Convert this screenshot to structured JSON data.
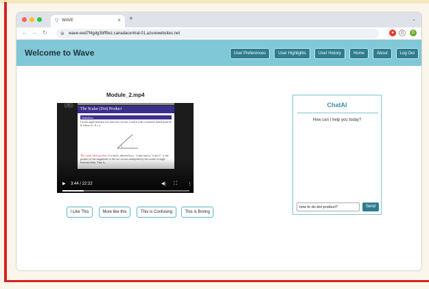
{
  "browser": {
    "tab_title": "WAVE",
    "new_tab": "+",
    "url": "wave-eed7f4gdg3bff9ez.canadacentral-01.azurewebsites.net",
    "profile_initial": "G"
  },
  "header": {
    "title": "Welcome to Wave",
    "nav": [
      "User Preferences",
      "User Highlights",
      "User History",
      "Home",
      "About",
      "Log Out"
    ],
    "color": "#80c7d7",
    "button_color": "#2e7d8f"
  },
  "video": {
    "title": "Module_2.mp4",
    "slide_heading": "The Scalar (Dot) Product",
    "slide_definition": "Definition",
    "slide_text": "Let the angle between two non-zero vectors u and b with a common initial point be θ, where 0 ≤ θ ≤ π.",
    "slide_text2_red": "The scalar (dot) product",
    "slide_text2": "of u and b, denoted by u · b and read as \"u dot b\", is the product of the magnitude of the two vectors multiplied by the cosine of angle between them. That is,",
    "time": "3:44 / 22:22",
    "progress": 0.17
  },
  "feedback_buttons": [
    "I Like This",
    "More like this",
    "This is Confusing",
    "This is Boring"
  ],
  "chat": {
    "title": "ChatAI",
    "greeting": "How can I help you today?",
    "input_value": "how to do dot product?",
    "send_label": "Send"
  }
}
